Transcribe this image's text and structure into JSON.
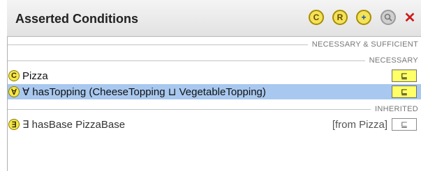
{
  "panel": {
    "title": "Asserted Conditions",
    "toolbar": {
      "add_class_icon": "C",
      "add_restriction_icon": "R",
      "add_expression_icon": "+",
      "find_icon": "find",
      "delete_icon": "✕"
    }
  },
  "sections": {
    "necessary_sufficient": "NECESSARY & SUFFICIENT",
    "necessary": "NECESSARY",
    "inherited": "INHERITED"
  },
  "rows": [
    {
      "badge": "C",
      "text": "Pizza",
      "subclass_symbol": "⊑"
    },
    {
      "badge": "∀",
      "text": "∀ hasTopping (CheeseTopping ⊔ VegetableTopping)",
      "subclass_symbol": "⊑"
    }
  ],
  "inherited_rows": [
    {
      "badge": "∃",
      "text": "∃ hasBase PizzaBase",
      "from": "[from Pizza]",
      "subclass_symbol": "⊑"
    }
  ]
}
